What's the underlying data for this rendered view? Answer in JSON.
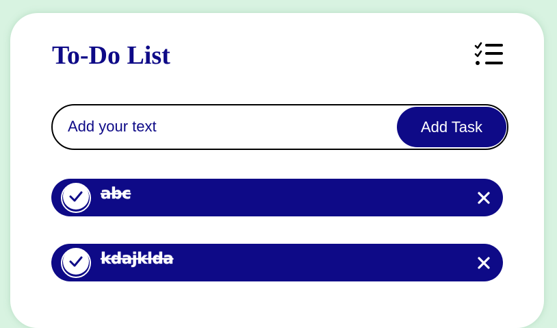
{
  "app": {
    "title": "To-Do List",
    "header_icon": "checklist-icon"
  },
  "input": {
    "placeholder": "Add your text",
    "value": "",
    "add_button_label": "Add Task"
  },
  "tasks": [
    {
      "text": "abc",
      "completed": true
    },
    {
      "text": "kdajklda",
      "completed": true
    }
  ],
  "colors": {
    "page_background": "#d8f3e1",
    "card_background": "#ffffff",
    "accent": "#0e0a87",
    "task_text": "#ffffff",
    "input_border": "#000000"
  },
  "icons": {
    "checked": "check-circle-icon",
    "delete": "close-icon"
  }
}
